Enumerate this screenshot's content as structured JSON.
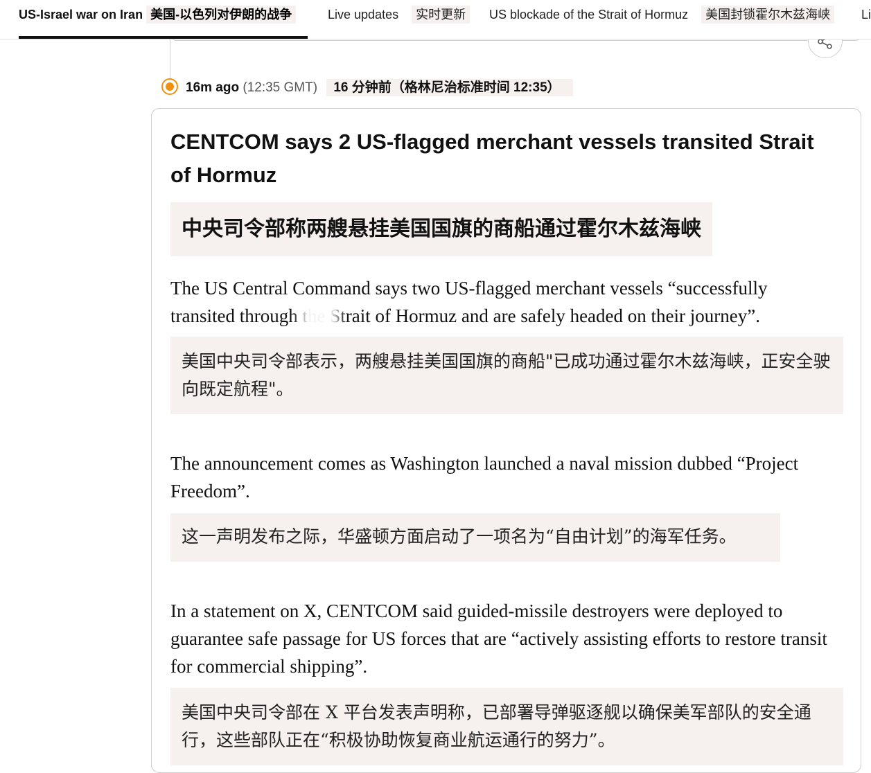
{
  "nav": {
    "items": [
      {
        "en": "US-Israel war on Iran",
        "zh": "美国-以色列对伊朗的战争",
        "active": true
      },
      {
        "en": "Live updates",
        "zh": "实时更新"
      },
      {
        "en": "US blockade of the Strait of Hormuz",
        "zh": "美国封锁霍尔木兹海峡"
      },
      {
        "en": "Li"
      }
    ]
  },
  "entry": {
    "time_ago": "16m ago",
    "time_gmt": "(12:35 GMT)",
    "time_zh": "16 分钟前（格林尼治标准时间 12:35）",
    "headline": "CENTCOM says 2 US-flagged merchant vessels transited Strait of Hormuz",
    "headline_zh": "中央司令部称两艘悬挂美国国旗的商船通过霍尔木兹海峡",
    "paragraphs": [
      {
        "en": "The US Central Command says two US-flagged merchant vessels “successfully transited through the Strait of Hormuz and are safely headed on their journey”.",
        "zh": "美国中央司令部表示，两艘悬挂美国国旗的商船\"已成功通过霍尔木兹海峡，正安全驶向既定航程\"。"
      },
      {
        "en": "The announcement comes as Washington launched a naval mission dubbed “Project Freedom”.",
        "zh": "这一声明发布之际，华盛顿方面启动了一项名为“自由计划”的海军任务。"
      },
      {
        "en": "In a statement on X, CENTCOM said guided-missile destroyers were deployed to guarantee safe passage for US forces that are “actively assisting efforts to restore transit for commercial shipping”.",
        "zh": "美国中央司令部在 X 平台发表声明称，已部署导弹驱逐舰以确保美军部队的安全通行，这些部队正在“积极协助恢复商业航运通行的努力”。"
      }
    ]
  },
  "colors": {
    "accent_live": "#f0900d",
    "translation_bg": "#f6f0ee",
    "border": "#cfcfcf"
  },
  "icons": {
    "share": "share-icon",
    "live": "live-dot-icon"
  }
}
